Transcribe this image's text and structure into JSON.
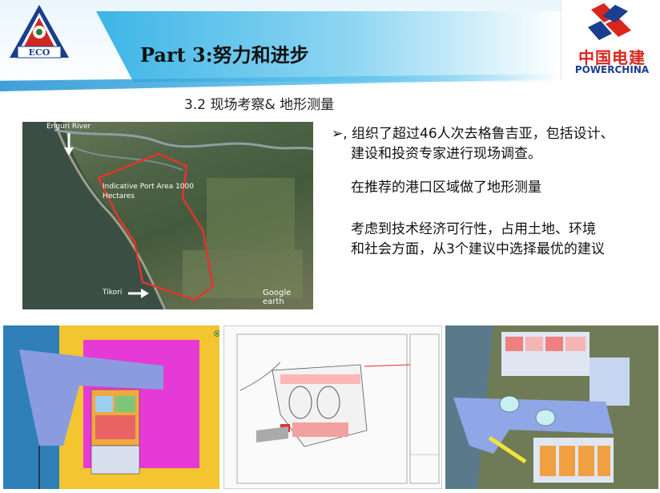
{
  "slide": {
    "title": "Part 3:努力和进步",
    "subtitle": "3.2  现场考察&  地形测量"
  },
  "logos": {
    "eco_text": "ECO",
    "powerchina_cn": "中国电建",
    "powerchina_en": "POWERCHINA"
  },
  "map": {
    "river_label": "Enguri River",
    "area_label_1": "Indicative Port Area 1000",
    "area_label_2": "Hectares",
    "tikori_label": "Tikori",
    "watermark": "Google earth"
  },
  "bullets": {
    "line1": "➢, 组织了超过46人次去格鲁吉亚，包括设计、",
    "line2": "建设和投资专家进行现场调查。",
    "line3": "在推荐的港口区域做了地形测量",
    "line4": "考虑到技术经济可行性，占用土地、环境",
    "line5": "和社会方面，从3个建议中选择最优的建议"
  },
  "colors": {
    "accent_blue": "#3db5e6",
    "brand_red": "#d9261c",
    "brand_navy": "#1b3f8f",
    "map_outline": "#e0362a"
  }
}
